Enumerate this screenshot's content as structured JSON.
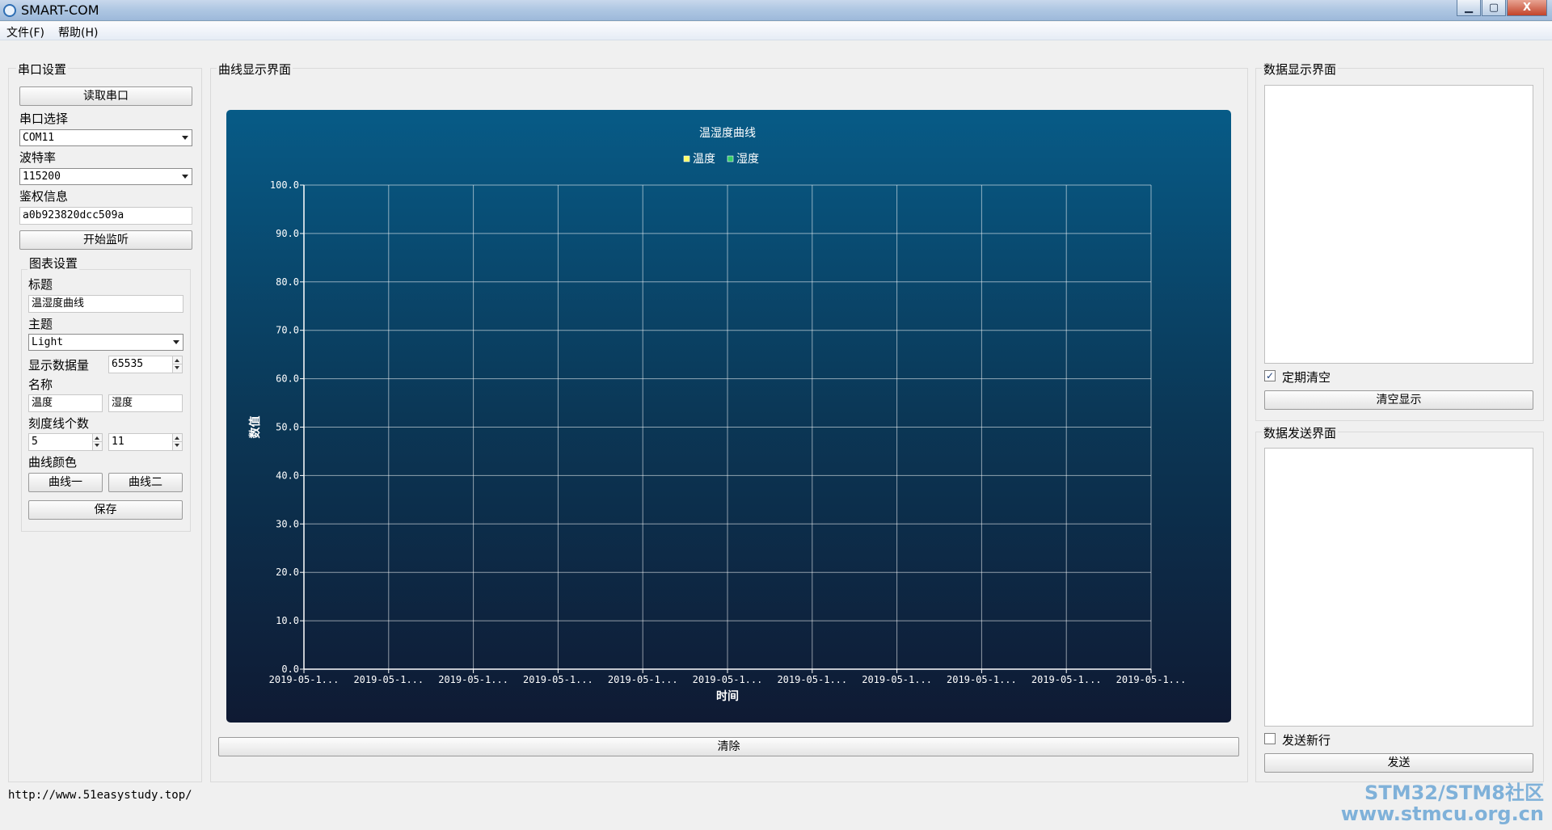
{
  "window": {
    "title": "SMART-COM",
    "minimize": "▁",
    "maximize": "▢",
    "close": "X"
  },
  "menu": {
    "file": "文件(F)",
    "help": "帮助(H)"
  },
  "serial": {
    "group_title": "串口设置",
    "read_button": "读取串口",
    "port_label": "串口选择",
    "port_value": "COM11",
    "baud_label": "波特率",
    "baud_value": "115200",
    "auth_label": "鉴权信息",
    "auth_value": "a0b923820dcc509a",
    "start_button": "开始监听"
  },
  "chart_settings": {
    "group_title": "图表设置",
    "title_label": "标题",
    "title_value": "温湿度曲线",
    "theme_label": "主题",
    "theme_value": "Light",
    "count_label": "显示数据量",
    "count_value": "65535",
    "name_label": "名称",
    "name1_value": "温度",
    "name2_value": "湿度",
    "tick_label": "刻度线个数",
    "tick1_value": "5",
    "tick2_value": "11",
    "color_label": "曲线颜色",
    "color1_button": "曲线一",
    "color2_button": "曲线二",
    "save_button": "保存"
  },
  "curve": {
    "group_title": "曲线显示界面",
    "clear_button": "清除"
  },
  "data_display": {
    "group_title": "数据显示界面",
    "auto_clear_label": "定期清空",
    "auto_clear_checked": true,
    "clear_button": "清空显示"
  },
  "data_send": {
    "group_title": "数据发送界面",
    "newline_label": "发送新行",
    "newline_checked": false,
    "send_button": "发送"
  },
  "status": {
    "url": "http://www.51easystudy.top/"
  },
  "watermark": {
    "line1": "STM32/STM8社区",
    "line2": "www.stmcu.org.cn"
  },
  "chart_data": {
    "type": "line",
    "title": "温湿度曲线",
    "xlabel": "时间",
    "ylabel": "数值",
    "ylim": [
      0,
      100
    ],
    "y_ticks": [
      "0.0",
      "10.0",
      "20.0",
      "30.0",
      "40.0",
      "50.0",
      "60.0",
      "70.0",
      "80.0",
      "90.0",
      "100.0"
    ],
    "x_ticks": [
      "2019-05-1...",
      "2019-05-1...",
      "2019-05-1...",
      "2019-05-1...",
      "2019-05-1...",
      "2019-05-1...",
      "2019-05-1...",
      "2019-05-1...",
      "2019-05-1...",
      "2019-05-1...",
      "2019-05-1..."
    ],
    "grid": true,
    "legend_position": "top",
    "series": [
      {
        "name": "温度",
        "color": "#ffff66",
        "values": []
      },
      {
        "name": "湿度",
        "color": "#33cc66",
        "values": []
      }
    ]
  }
}
